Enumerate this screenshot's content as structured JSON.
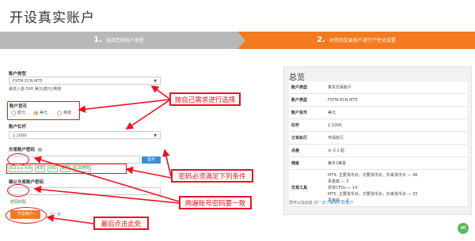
{
  "page": {
    "title": "开设真实账户"
  },
  "steps": [
    {
      "num": "1.",
      "label": "选择您的账户类型"
    },
    {
      "num": "2.",
      "label": "对您的交易账户进行个性化设置"
    }
  ],
  "form": {
    "account_type_label": "账户类型",
    "account_type_value": "FXTM ECN MT5",
    "min_deposit": "最低入金:500 美元/欧元/英镑",
    "currency_label": "账户货币",
    "currency_options": [
      "欧元",
      "美元",
      "英镑"
    ],
    "currency_selected": "美元",
    "leverage_label": "账户杠杆",
    "leverage_value": "1:1000",
    "password_label": "交易账户密码",
    "password_hint_icon": "info-icon",
    "show_button": "显示",
    "password_requirements": [
      "6-2 a-z, 0-9",
      "大写",
      "小写",
      "数字",
      "6-20字符"
    ],
    "confirm_label": "确认交易账户密码",
    "match_text": "密码匹配",
    "open_button": "开设账户",
    "back_link": "上一步"
  },
  "summary": {
    "title": "总览",
    "rows": [
      {
        "k": "账户类型",
        "v": "真实交易账户"
      },
      {
        "k": "账户类型",
        "v": "FXTM ECN MT5"
      },
      {
        "k": "账户货币",
        "v": "美元"
      },
      {
        "k": "杠杆",
        "v": "1:1000"
      },
      {
        "k": "订单执行",
        "v": "市场执行"
      },
      {
        "k": "点差",
        "v": "从 0.1 起"
      },
      {
        "k": "佣金",
        "v": "每手2美金"
      },
      {
        "k": "交易工具",
        "lines": [
          "MT4: 主要货币对，次要货币对，外来货币对 — 48",
          "贵金属 — 3",
          "现货CFDs — 14",
          "MT5: 主要货币对，次要货币对，外来货币对 — 33",
          "贵金属 — 2"
        ]
      }
    ],
    "foot_text": "您可以在此处",
    "foot_link": "进一步了解我们的账户"
  },
  "callouts": {
    "c1": "按自己需求进行选择",
    "c2": "密码必须满足下列条件",
    "c3": "两遍账号密码要一致",
    "c4": "最后点击此处"
  },
  "colors": {
    "accent": "#f47b20",
    "annotation": "#ee1122",
    "link": "#3a8fd6"
  }
}
